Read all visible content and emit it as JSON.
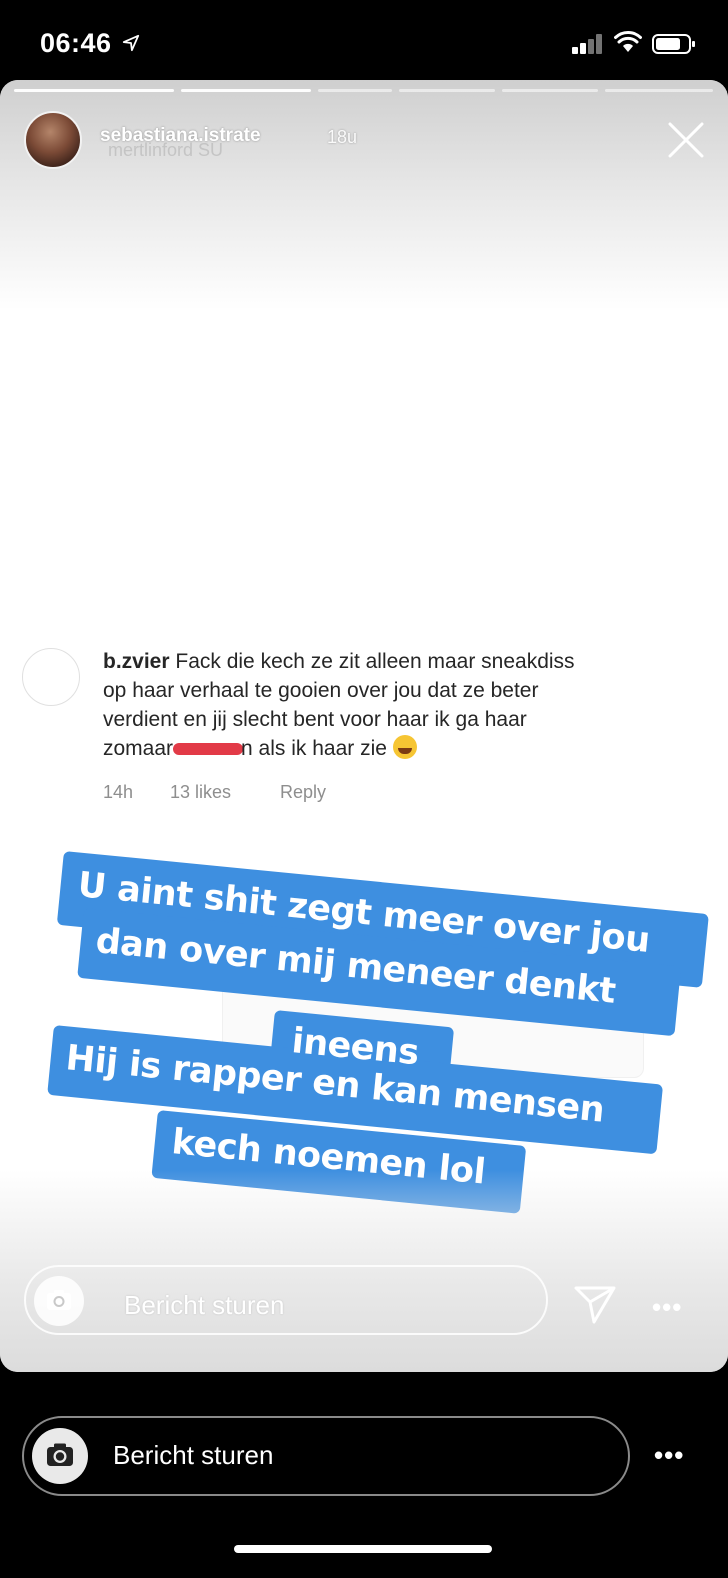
{
  "status_bar": {
    "time": "06:46",
    "icons": [
      "location-arrow-icon",
      "cellular-signal-icon",
      "wifi-icon",
      "battery-icon"
    ]
  },
  "story": {
    "username": "sebastiana.istrate",
    "ghost_username": "mertlinford  SU",
    "timestamp": "18u",
    "progress_segments": 6,
    "progress_done": 2,
    "comment": {
      "username": "b.zvier",
      "lines": [
        "Fack die kech ze zit alleen maar sneakdiss",
        "op haar verhaal te gooien over jou dat ze beter",
        "verdient en jij slecht bent voor haar ik ga haar"
      ],
      "last_line_before": "zomaar",
      "last_line_after": "n als ik haar zie",
      "time": "14h",
      "likes": "13 likes",
      "reply": "Reply"
    },
    "sticker_lines": [
      "U aint shit zegt meer over jou",
      "dan over mij meneer denkt",
      "ineens",
      "Hij is rapper en kan mensen",
      "kech noemen lol"
    ],
    "sticker_color": "#3e8fe0",
    "reply_placeholder": "Bericht sturen"
  },
  "reply_bar": {
    "placeholder": "Bericht sturen",
    "more": "•••"
  }
}
